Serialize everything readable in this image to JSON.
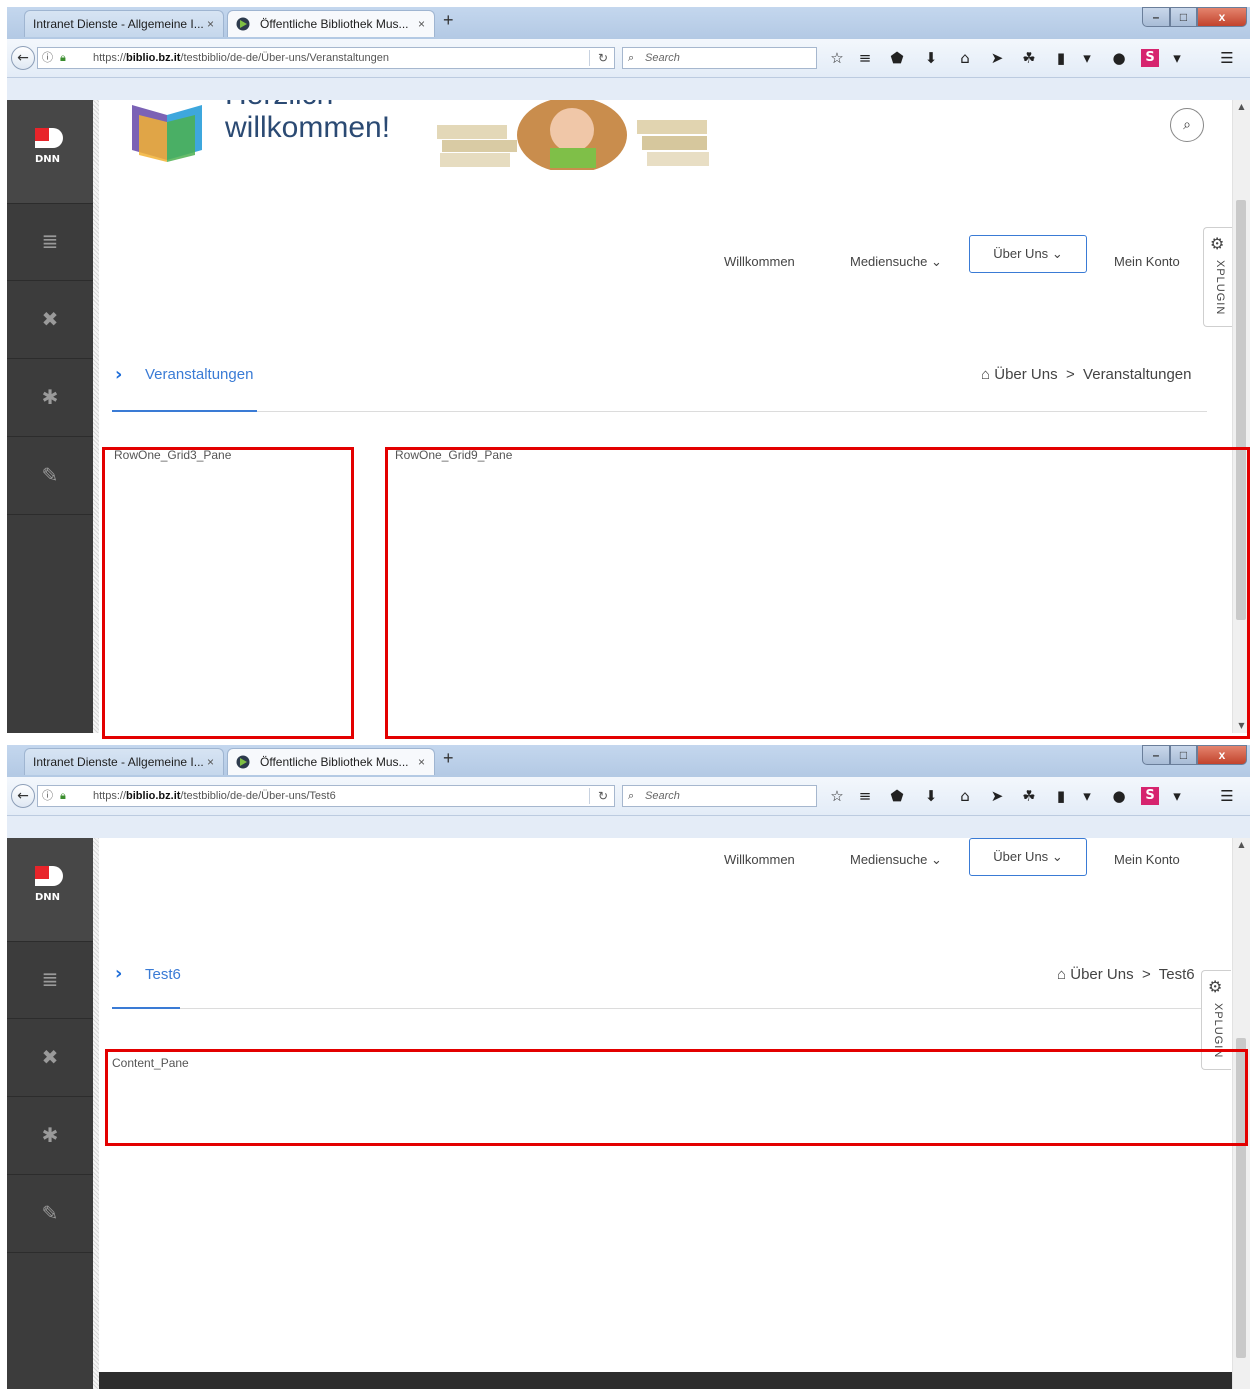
{
  "browser": {
    "tab_inactive_label": "Intranet Dienste - Allgemeine I...",
    "tab_active_label": "Öffentliche Bibliothek Mus...",
    "tab_close_glyph": "×",
    "new_tab_glyph": "+",
    "search_placeholder": "Search",
    "window_min": "–",
    "window_max": "□",
    "window_close": "x"
  },
  "shot1": {
    "url_host": "biblio.bz.it",
    "url_prefix": "https://",
    "url_path": "/testbiblio/de-de/Über-uns/Veranstaltungen",
    "banner_heading_line1": "Herzlich",
    "banner_heading_line2": "willkommen!",
    "page_title": "Veranstaltungen",
    "breadcrumb_parent": "Über Uns",
    "breadcrumb_separator": ">",
    "breadcrumb_current": "Veranstaltungen",
    "pane_left_label": "RowOne_Grid3_Pane",
    "pane_right_label": "RowOne_Grid9_Pane"
  },
  "shot2": {
    "url_host": "biblio.bz.it",
    "url_prefix": "https://",
    "url_path": "/testbiblio/de-de/Über-uns/Test6",
    "page_title": "Test6",
    "breadcrumb_parent": "Über Uns",
    "breadcrumb_separator": ">",
    "breadcrumb_current": "Test6",
    "content_pane_label": "Content_Pane"
  },
  "menu": {
    "item1": "Willkommen",
    "item2": "Mediensuche",
    "item3": "Über Uns",
    "item4": "Mein Konto",
    "chevron": "⌄"
  },
  "xplugin_label": "XPLUGIN",
  "dnn_logo_text": "DNN",
  "icons": [
    "back-arrow-icon",
    "info-icon",
    "lock-icon",
    "reload-icon",
    "search-icon",
    "star-icon",
    "reading-list-icon",
    "pocket-icon",
    "download-icon",
    "home-icon",
    "send-icon",
    "puzzle-icon",
    "clipboard-icon",
    "dropdown-icon",
    "circle-icon",
    "s-logo-icon",
    "hamburger-menu-icon",
    "pages-icon",
    "tools-icon",
    "settings-icon",
    "edit-icon",
    "gear-icon",
    "home-icon"
  ],
  "colors": {
    "accent": "#3a7bd5",
    "highlight_box": "#e30000",
    "sidebar": "#3c3c3c"
  }
}
